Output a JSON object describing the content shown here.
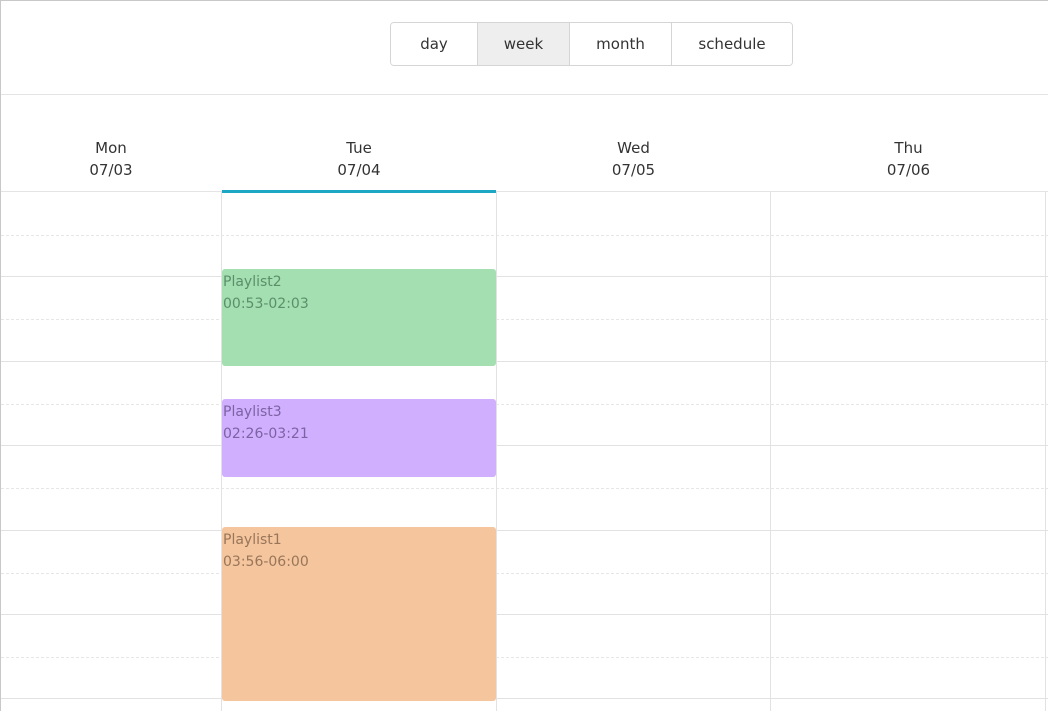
{
  "toolbar": {
    "views": [
      {
        "label": "day",
        "active": false
      },
      {
        "label": "week",
        "active": true
      },
      {
        "label": "month",
        "active": false
      },
      {
        "label": "schedule",
        "active": false
      }
    ]
  },
  "days": [
    {
      "weekday": "Mon",
      "date": "07/03"
    },
    {
      "weekday": "Tue",
      "date": "07/04",
      "today": true
    },
    {
      "weekday": "Wed",
      "date": "07/05"
    },
    {
      "weekday": "Thu",
      "date": "07/06"
    }
  ],
  "events": [
    {
      "title": "Playlist2",
      "time": "00:53-02:03",
      "day": "Tue",
      "color": "#a3dfb1"
    },
    {
      "title": "Playlist3",
      "time": "02:26-03:21",
      "day": "Tue",
      "color": "#d1afff"
    },
    {
      "title": "Playlist1",
      "time": "03:56-06:00",
      "day": "Tue",
      "color": "#f5c59d"
    }
  ],
  "colors": {
    "today_accent": "#1ea7c5",
    "active_view_bg": "#eeeeee"
  }
}
